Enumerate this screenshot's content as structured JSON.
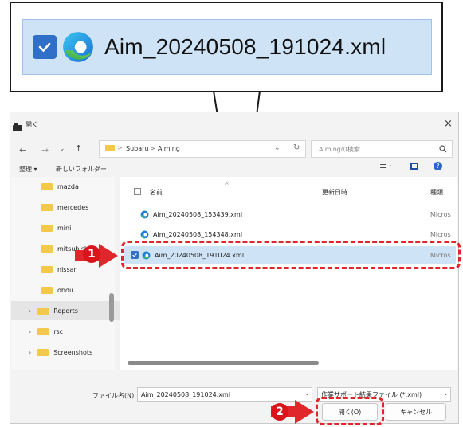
{
  "callout": {
    "filename": "Aim_20240508_191024.xml"
  },
  "window": {
    "title": "開く",
    "close": "×"
  },
  "address": {
    "folder_parent": "Subaru",
    "sep": ">",
    "folder_current": "Aiming",
    "search_placeholder": "Aimingの検索"
  },
  "toolbar": {
    "organize": "整理 ▾",
    "new_folder": "新しいフォルダー"
  },
  "sidebar": {
    "items": [
      {
        "label": "mazda"
      },
      {
        "label": "mercedes"
      },
      {
        "label": "mini"
      },
      {
        "label": "mitsubishi"
      },
      {
        "label": "nissan"
      },
      {
        "label": "obdii"
      },
      {
        "label": "Reports"
      },
      {
        "label": "rsc"
      },
      {
        "label": "Screenshots"
      }
    ]
  },
  "columns": {
    "name": "名前",
    "date": "更新日時",
    "type": "種類"
  },
  "files": [
    {
      "name": "Aim_20240508_153439.xml",
      "type": "Micros"
    },
    {
      "name": "Aim_20240508_154348.xml",
      "type": "Micros"
    },
    {
      "name": "Aim_20240508_191024.xml",
      "type": "Micros"
    }
  ],
  "footer": {
    "filename_label": "ファイル名(N):",
    "filename_value": "Aim_20240508_191024.xml",
    "filter_value": "作業サポート結果ファイル (*.xml)",
    "open_button": "開く(O)",
    "cancel_button": "キャンセル"
  },
  "annotations": {
    "badge1": "1",
    "badge2": "2"
  },
  "colors": {
    "highlight": "#e0262b",
    "selection": "#cfe3f6",
    "accent": "#2f6fc7"
  }
}
